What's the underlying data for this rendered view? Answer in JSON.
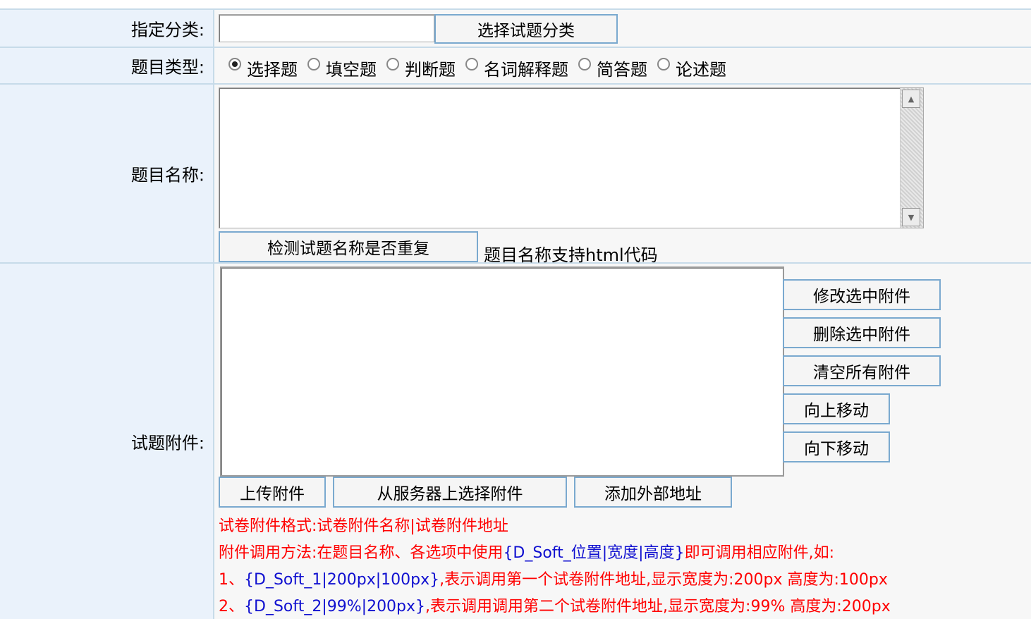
{
  "category": {
    "label": "指定分类:",
    "value": "",
    "button": "选择试题分类"
  },
  "type": {
    "label": "题目类型:",
    "options": [
      "选择题",
      "填空题",
      "判断题",
      "名词解释题",
      "简答题",
      "论述题"
    ],
    "selected": "选择题"
  },
  "title": {
    "label": "题目名称:",
    "value": "",
    "check_button": "检测试题名称是否重复",
    "hint": "题目名称支持html代码"
  },
  "attachments": {
    "label": "试题附件:",
    "side_buttons": [
      "修改选中附件",
      "删除选中附件",
      "清空所有附件"
    ],
    "move_up": "向上移动",
    "move_down": "向下移动",
    "upload": "上传附件",
    "select_from_server": "从服务器上选择附件",
    "add_external": "添加外部地址",
    "notes": {
      "line1": "试卷附件格式:试卷附件名称|试卷附件地址",
      "line2_red": "附件调用方法:在题目名称、各选项中使用",
      "line2_blue": "{D_Soft_位置|宽度|高度}",
      "line2_red2": "即可调用相应附件,如:",
      "line3_red": "1、",
      "line3_blue": "{D_Soft_1|200px|100px}",
      "line3_red2": ",表示调用第一个试卷附件地址,显示宽度为:200px 高度为:100px",
      "line4_red": "2、",
      "line4_blue": "{D_Soft_2|99%|200px}",
      "line4_red2": ",表示调用调用第二个试卷附件地址,显示宽度为:99% 高度为:200px"
    }
  }
}
